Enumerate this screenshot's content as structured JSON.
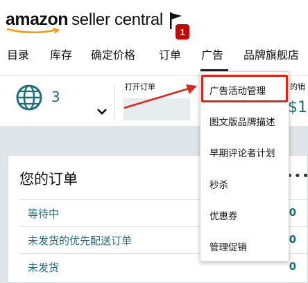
{
  "header": {
    "logo_brand": "amazon",
    "logo_product": "seller central",
    "notification_count": "1",
    "nav": [
      {
        "label": "目录"
      },
      {
        "label": "库存"
      },
      {
        "label": "确定价格"
      },
      {
        "label": "订单"
      },
      {
        "label": "广告"
      },
      {
        "label": "品牌旗舰店"
      }
    ]
  },
  "stats": {
    "marketplace_count": "3",
    "open_orders_label": "打开订单",
    "right_label_partial": "的销",
    "right_value_partial": "$1"
  },
  "orders_card": {
    "title": "您的订单",
    "more": "•••",
    "rows": [
      {
        "label": "等待中",
        "value": "0"
      },
      {
        "label": "未发货的优先配送订单",
        "value": "0"
      },
      {
        "label": "未发货",
        "value": "0"
      }
    ]
  },
  "ads_menu": {
    "items": [
      {
        "label": "广告活动管理"
      },
      {
        "label": "图文版品牌描述"
      },
      {
        "label": "早期评论者计划"
      },
      {
        "label": "秒杀"
      },
      {
        "label": "优惠券"
      },
      {
        "label": "管理促销"
      }
    ],
    "highlighted_index": 0
  },
  "colors": {
    "teal_link": "#1f6f79",
    "badge_red": "#c40000",
    "highlight_red": "#d9281c",
    "page_grey": "#dfe5e8"
  },
  "icons": [
    "flag-icon",
    "globe-icon",
    "chevron-down-icon",
    "annotation-arrow"
  ]
}
